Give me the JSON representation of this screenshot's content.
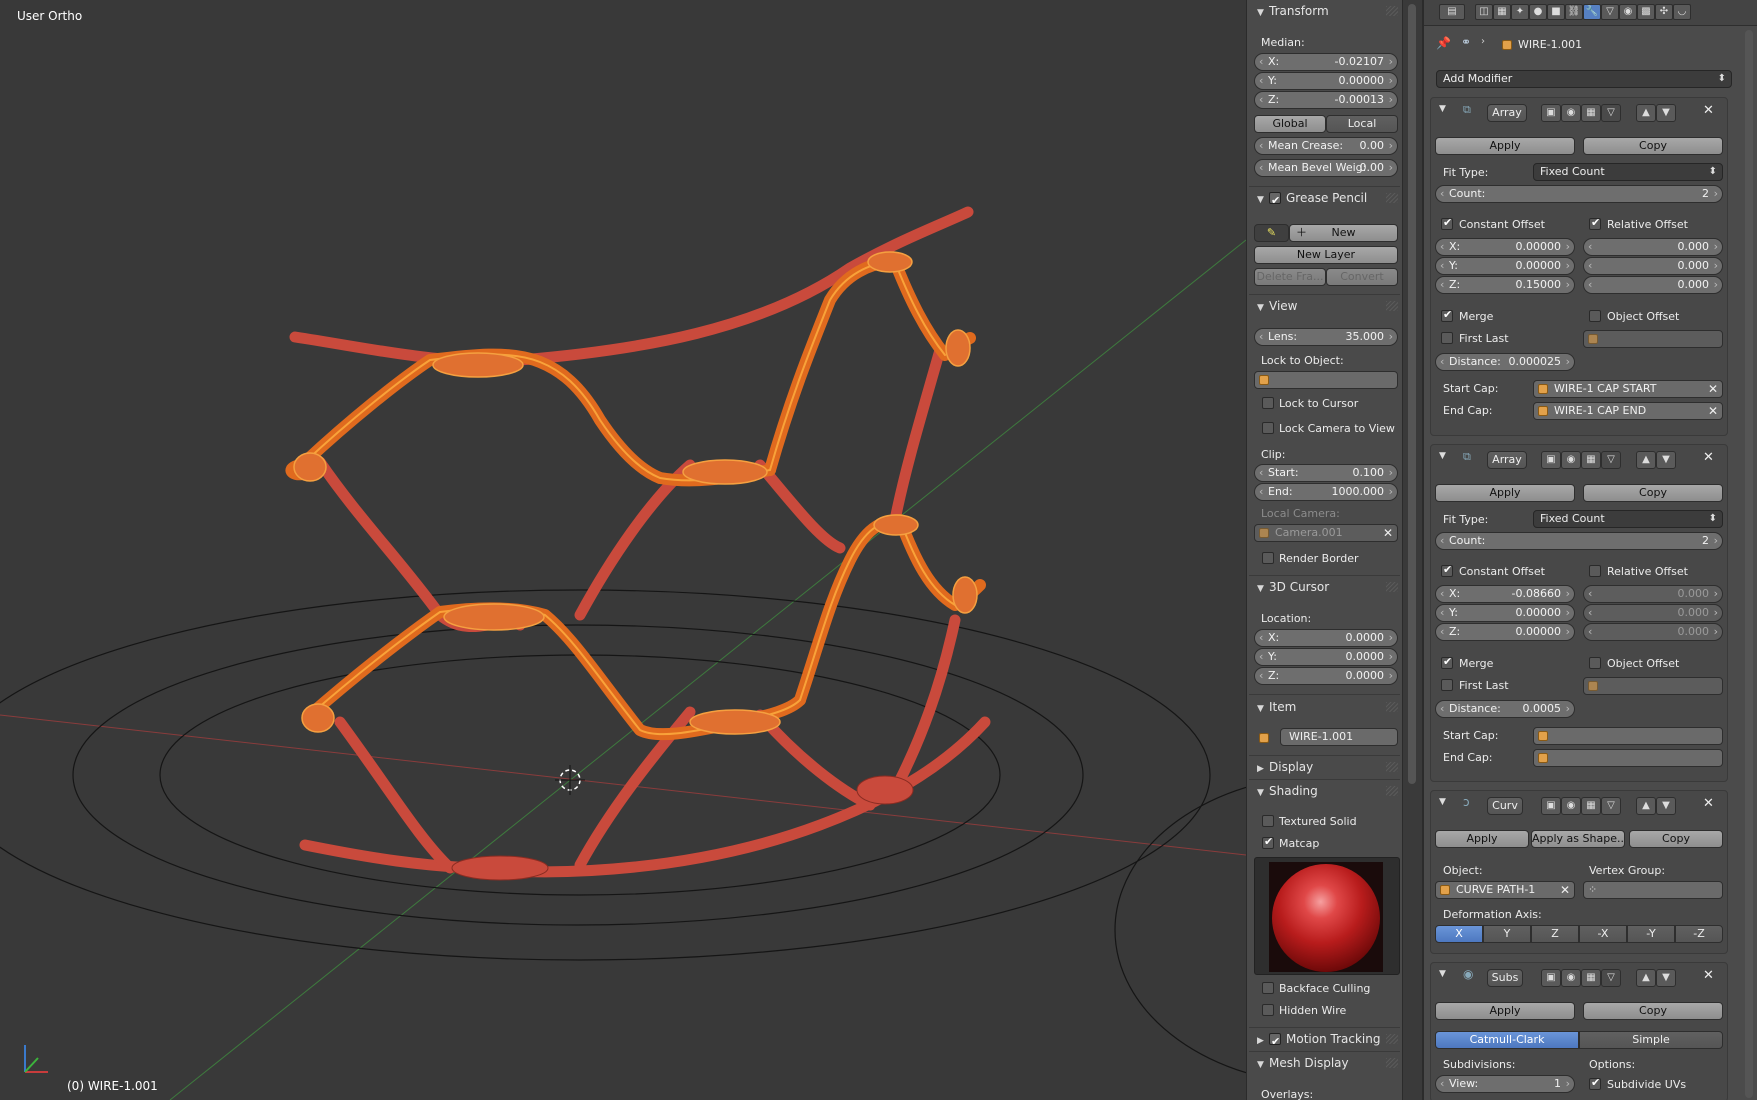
{
  "viewport": {
    "view_label": "User Ortho",
    "object_label": "(0) WIRE-1.001"
  },
  "npanel": {
    "transform": {
      "title": "Transform",
      "median_label": "Median:",
      "x_label": "X:",
      "x_value": "-0.02107",
      "y_label": "Y:",
      "y_value": "0.00000",
      "z_label": "Z:",
      "z_value": "-0.00013",
      "global_label": "Global",
      "local_label": "Local",
      "mean_crease_label": "Mean Crease:",
      "mean_crease_value": "0.00",
      "mean_bevel_label": "Mean Bevel Weig:",
      "mean_bevel_value": "0.00"
    },
    "grease_pencil": {
      "title": "Grease Pencil",
      "new_label": "New",
      "new_layer_label": "New Layer",
      "delete_frame_label": "Delete Fra...",
      "convert_label": "Convert"
    },
    "view": {
      "title": "View",
      "lens_label": "Lens:",
      "lens_value": "35.000",
      "lock_to_object_label": "Lock to Object:",
      "lock_to_cursor_label": "Lock to Cursor",
      "lock_camera_label": "Lock Camera to View",
      "clip_label": "Clip:",
      "start_label": "Start:",
      "start_value": "0.100",
      "end_label": "End:",
      "end_value": "1000.000",
      "local_camera_label": "Local Camera:",
      "local_camera_value": "Camera.001",
      "render_border_label": "Render Border"
    },
    "cursor": {
      "title": "3D Cursor",
      "location_label": "Location:",
      "x_label": "X:",
      "x_value": "0.0000",
      "y_label": "Y:",
      "y_value": "0.0000",
      "z_label": "Z:",
      "z_value": "0.0000"
    },
    "item": {
      "title": "Item",
      "name": "WIRE-1.001"
    },
    "display": {
      "title": "Display"
    },
    "shading": {
      "title": "Shading",
      "textured_solid_label": "Textured Solid",
      "matcap_label": "Matcap",
      "backface_label": "Backface Culling",
      "hidden_wire_label": "Hidden Wire"
    },
    "motion_tracking": {
      "title": "Motion Tracking"
    },
    "mesh_display": {
      "title": "Mesh Display",
      "overlays_label": "Overlays:"
    }
  },
  "props": {
    "object_name": "WIRE-1.001",
    "add_modifier_label": "Add Modifier",
    "modifiers": [
      {
        "name": "Array",
        "apply_label": "Apply",
        "copy_label": "Copy",
        "fit_type_label": "Fit Type:",
        "fit_type_value": "Fixed Count",
        "count_label": "Count:",
        "count_value": "2",
        "constant_offset_label": "Constant Offset",
        "relative_offset_label": "Relative Offset",
        "cx_label": "X:",
        "cx_value": "0.00000",
        "cy_label": "Y:",
        "cy_value": "0.00000",
        "cz_label": "Z:",
        "cz_value": "0.15000",
        "rx_value": "0.000",
        "ry_value": "0.000",
        "rz_value": "0.000",
        "merge_label": "Merge",
        "object_offset_label": "Object Offset",
        "first_last_label": "First Last",
        "distance_label": "Distance:",
        "distance_value": "0.000025",
        "start_cap_label": "Start Cap:",
        "start_cap_value": "WIRE-1 CAP START",
        "end_cap_label": "End Cap:",
        "end_cap_value": "WIRE-1 CAP END"
      },
      {
        "name": "Array",
        "apply_label": "Apply",
        "copy_label": "Copy",
        "fit_type_label": "Fit Type:",
        "fit_type_value": "Fixed Count",
        "count_label": "Count:",
        "count_value": "2",
        "constant_offset_label": "Constant Offset",
        "relative_offset_label": "Relative Offset",
        "cx_label": "X:",
        "cx_value": "-0.08660",
        "cy_label": "Y:",
        "cy_value": "0.00000",
        "cz_label": "Z:",
        "cz_value": "0.00000",
        "rx_value": "0.000",
        "ry_value": "0.000",
        "rz_value": "0.000",
        "merge_label": "Merge",
        "object_offset_label": "Object Offset",
        "first_last_label": "First Last",
        "distance_label": "Distance:",
        "distance_value": "0.0005",
        "start_cap_label": "Start Cap:",
        "start_cap_value": "",
        "end_cap_label": "End Cap:",
        "end_cap_value": ""
      },
      {
        "name": "Curv",
        "apply_label": "Apply",
        "apply_shape_label": "Apply as Shape...",
        "copy_label": "Copy",
        "object_label": "Object:",
        "object_value": "CURVE PATH-1",
        "vertex_group_label": "Vertex Group:",
        "deformation_axis_label": "Deformation Axis:",
        "axes": [
          "X",
          "Y",
          "Z",
          "-X",
          "-Y",
          "-Z"
        ]
      },
      {
        "name": "Subs",
        "apply_label": "Apply",
        "copy_label": "Copy",
        "catmull_label": "Catmull-Clark",
        "simple_label": "Simple",
        "subdivisions_label": "Subdivisions:",
        "options_label": "Options:",
        "view_label": "View:",
        "view_value": "1",
        "subdivide_uvs_label": "Subdivide UVs"
      }
    ]
  }
}
